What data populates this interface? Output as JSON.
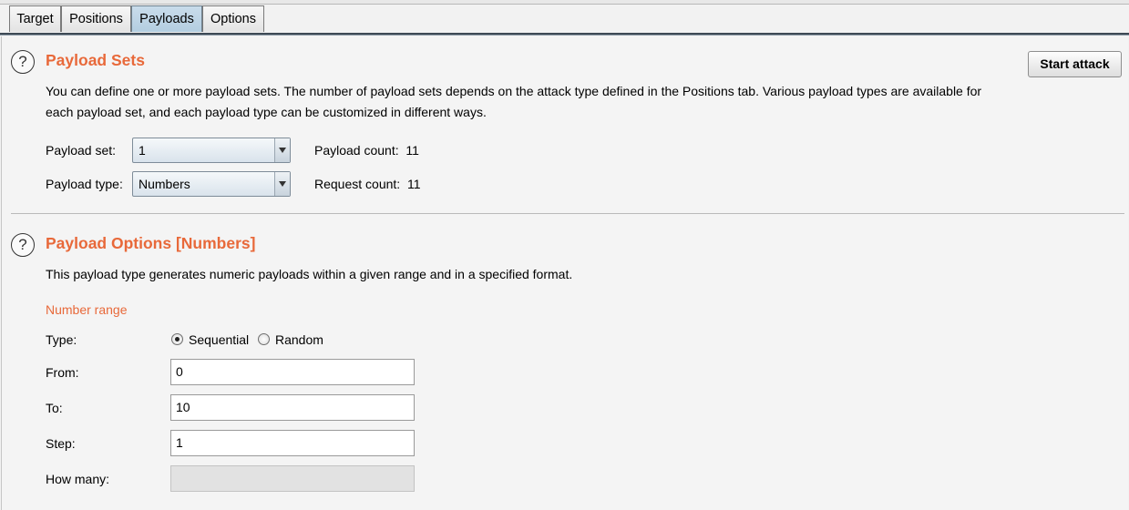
{
  "tabs": [
    {
      "label": "Target"
    },
    {
      "label": "Positions"
    },
    {
      "label": "Payloads"
    },
    {
      "label": "Options"
    }
  ],
  "active_tab": "Payloads",
  "payload_sets": {
    "title": "Payload Sets",
    "description_line1": "You can define one or more payload sets. The number of payload sets depends on the attack type defined in the Positions tab. Various payload types are available for",
    "description_line2": "each payload set, and each payload type can be customized in different ways.",
    "start_attack_label": "Start attack",
    "payload_set_label": "Payload set:",
    "payload_set_value": "1",
    "payload_type_label": "Payload type:",
    "payload_type_value": "Numbers",
    "payload_count_label": "Payload count:",
    "payload_count_value": "11",
    "request_count_label": "Request count:",
    "request_count_value": "11"
  },
  "payload_options": {
    "title": "Payload Options [Numbers]",
    "description": "This payload type generates numeric payloads within a given range and in a specified format.",
    "subheading": "Number range",
    "type_label": "Type:",
    "type_options": [
      "Sequential",
      "Random"
    ],
    "type_selected": "Sequential",
    "from_label": "From:",
    "from_value": "0",
    "to_label": "To:",
    "to_value": "10",
    "step_label": "Step:",
    "step_value": "1",
    "how_many_label": "How many:",
    "how_many_value": ""
  },
  "icons": {
    "help": "?"
  },
  "colors": {
    "accent": "#e8693a",
    "active_tab": "#b9d0e2"
  }
}
